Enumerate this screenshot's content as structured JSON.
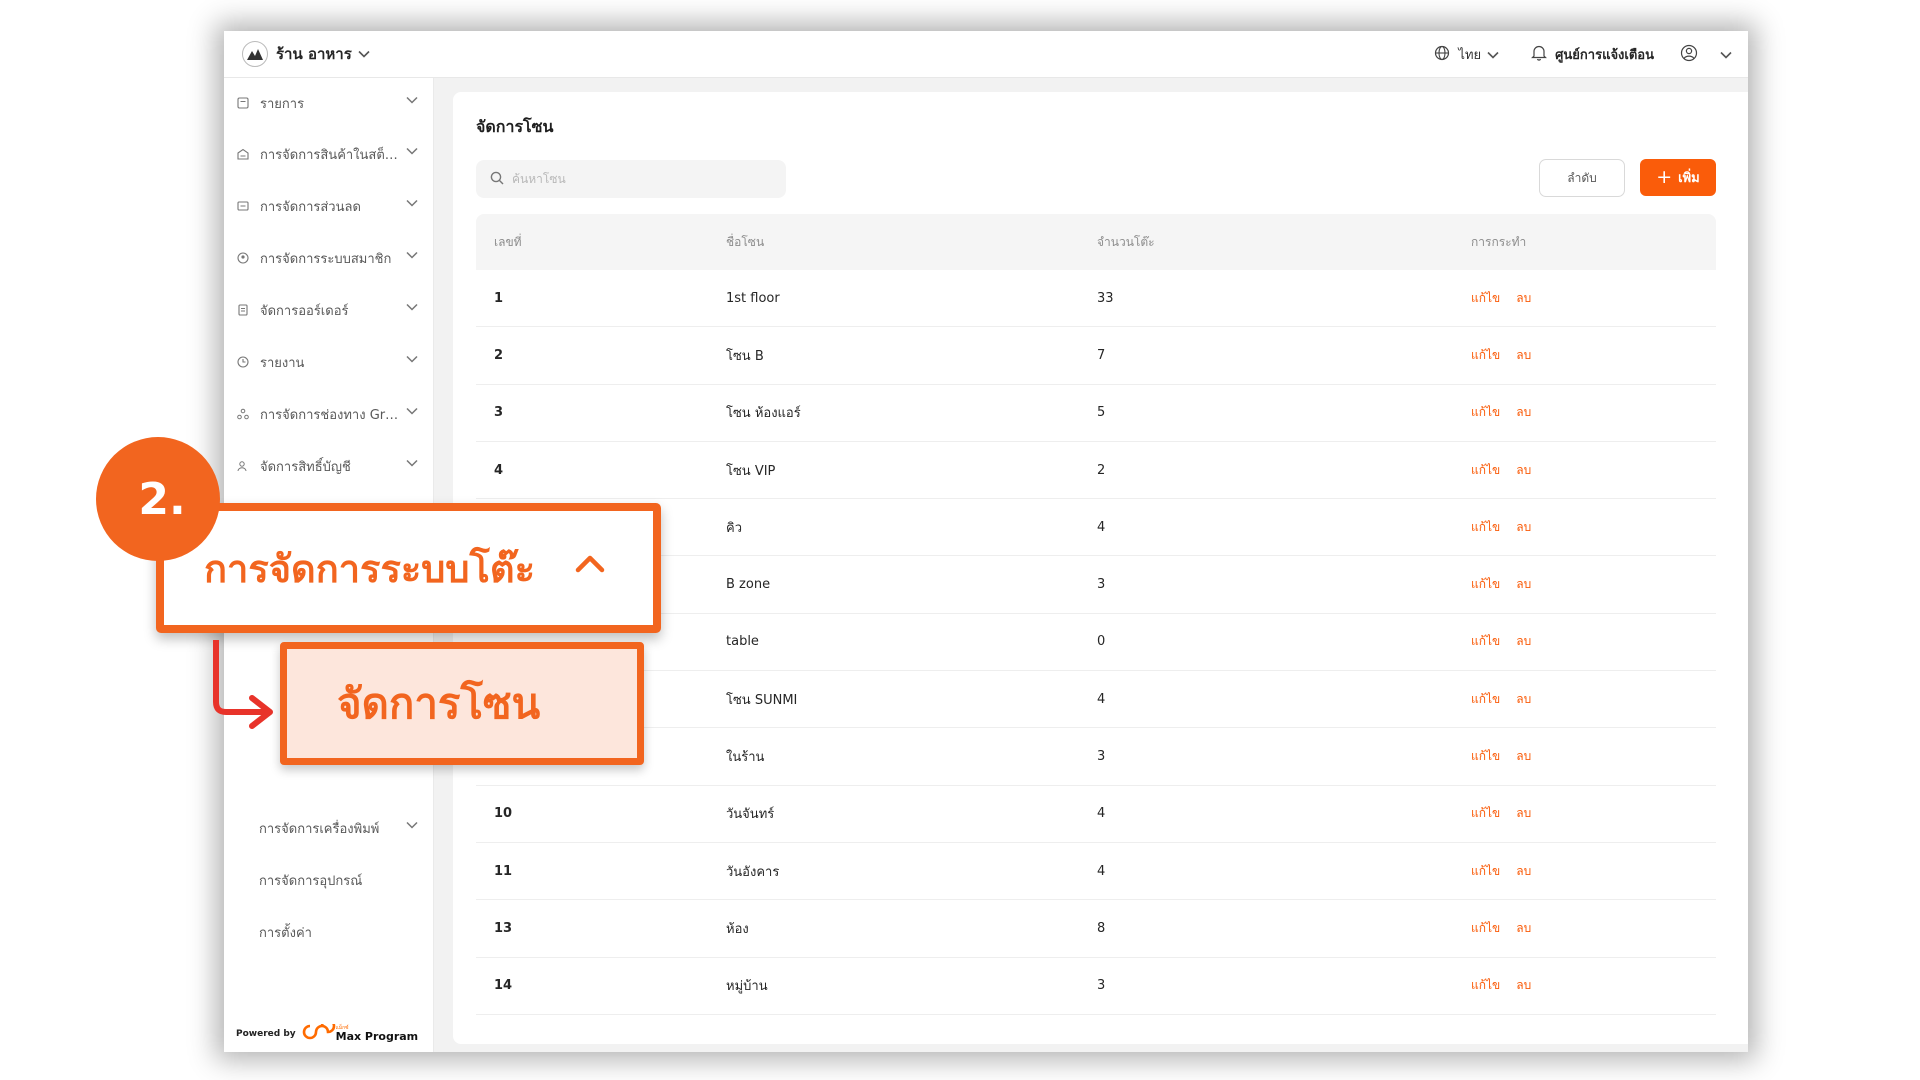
{
  "header": {
    "store_name": "ร้าน อาหาร",
    "language": "ไทย",
    "notification_center": "ศูนย์การแจ้งเตือน"
  },
  "sidebar": {
    "items": [
      {
        "label": "รายการ",
        "icon": "list-icon"
      },
      {
        "label": "การจัดการสินค้าในสต็อก",
        "icon": "warehouse-icon"
      },
      {
        "label": "การจัดการส่วนลด",
        "icon": "discount-icon"
      },
      {
        "label": "การจัดการระบบสมาชิก",
        "icon": "member-icon"
      },
      {
        "label": "จัดการออร์เดอร์",
        "icon": "order-icon"
      },
      {
        "label": "รายงาน",
        "icon": "clock-icon"
      },
      {
        "label": "การจัดการช่องทาง Grab",
        "icon": "channel-icon"
      },
      {
        "label": "จัดการสิทธิ์บัญชี",
        "icon": "account-icon"
      }
    ],
    "sub_items": [
      {
        "label": "การจัดการเครื่องพิมพ์"
      },
      {
        "label": "การจัดการอุปกรณ์"
      },
      {
        "label": "การตั้งค่า"
      }
    ],
    "powered_by": "Powered by",
    "powered_brand_sub": "แม็กซ์",
    "powered_brand": "Max Program"
  },
  "main": {
    "title": "จัดการโซน",
    "search_placeholder": "ค้นหาโซน",
    "sort_label": "ลำดับ",
    "add_label": "เพิ่ม",
    "columns": [
      "เลขที่",
      "ชื่อโซน",
      "จำนวนโต๊ะ",
      "การกระทำ"
    ],
    "edit_label": "แก้ไข",
    "delete_label": "ลบ",
    "rows": [
      {
        "no": "1",
        "name": "1st floor",
        "tables": "33"
      },
      {
        "no": "2",
        "name": "โซน B",
        "tables": "7"
      },
      {
        "no": "3",
        "name": "โซน ห้องแอร์",
        "tables": "5"
      },
      {
        "no": "4",
        "name": "โซน VIP",
        "tables": "2"
      },
      {
        "no": "",
        "name": "คิว",
        "tables": "4"
      },
      {
        "no": "",
        "name": "B zone",
        "tables": "3"
      },
      {
        "no": "",
        "name": "table",
        "tables": "0"
      },
      {
        "no": "",
        "name": "โซน SUNMI",
        "tables": "4"
      },
      {
        "no": "",
        "name": "ในร้าน",
        "tables": "3"
      },
      {
        "no": "10",
        "name": "วันจันทร์",
        "tables": "4"
      },
      {
        "no": "11",
        "name": "วันอังคาร",
        "tables": "4"
      },
      {
        "no": "13",
        "name": "ห้อง",
        "tables": "8"
      },
      {
        "no": "14",
        "name": "หมู่บ้าน",
        "tables": "3"
      }
    ]
  },
  "tutorial": {
    "step": "2.",
    "menu_label": "การจัดการระบบโต๊ะ",
    "submenu_label": "จัดการโซน"
  },
  "colors": {
    "accent": "#fa5c0a",
    "tutorial_orange": "#f2651f",
    "arrow_red": "#e8332a",
    "sub_highlight": "#fde6dc"
  }
}
